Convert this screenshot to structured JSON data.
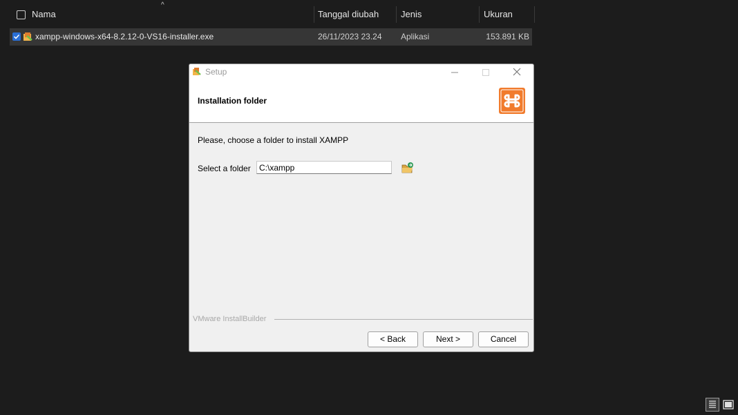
{
  "explorer": {
    "columns": {
      "name": "Nama",
      "date": "Tanggal diubah",
      "type": "Jenis",
      "size": "Ukuran"
    },
    "file": {
      "name": "xampp-windows-x64-8.2.12-0-VS16-installer.exe",
      "date": "26/11/2023 23.24",
      "type": "Aplikasi",
      "size": "153.891 KB"
    }
  },
  "dialog": {
    "title": "Setup",
    "heading": "Installation folder",
    "prompt": "Please, choose a folder to install XAMPP",
    "folder_label": "Select a folder",
    "folder_value": "C:\\xampp",
    "brand": "VMware InstallBuilder",
    "buttons": {
      "back": "< Back",
      "next": "Next >",
      "cancel": "Cancel"
    }
  }
}
